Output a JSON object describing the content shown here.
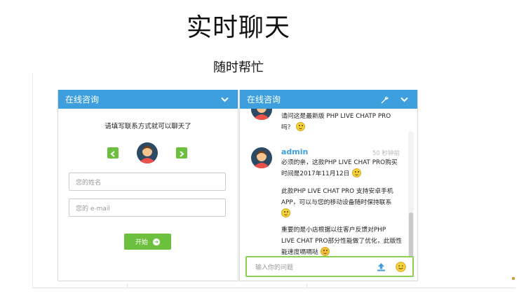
{
  "page": {
    "title": "实时聊天",
    "subtitle": "随时帮忙"
  },
  "left_panel": {
    "header": "在线咨询",
    "prompt": "请填写联系方式就可以聊天了",
    "name_placeholder": "您的姓名",
    "email_placeholder": "您的 e-mail",
    "start_label": "开始"
  },
  "right_panel": {
    "header": "在线咨询",
    "messages": [
      {
        "sender": "",
        "time": "",
        "lines": [
          "请问这是最新版 PHP LIVE CHATP PRO",
          "吗？"
        ]
      },
      {
        "sender": "admin",
        "time": "50 秒钟前",
        "paragraphs": [
          [
            "必须的亲，这款PHP LIVE CHAT PRO购买",
            "时间是2017年11月12日"
          ],
          [
            "此款PHP LIVE CHAT PRO 支持安卓手机",
            "APP，可以与您的移动设备随时保持联系"
          ],
          [
            "重要的是小店根据以往客户反馈对PHP",
            "LIVE CHAT PRO部分性能做了优化，此版性",
            "能速度嗝嗝哒"
          ]
        ]
      }
    ],
    "input_placeholder": "输入你的问题"
  },
  "icons": {
    "header_toggle": "chevron-down-icon",
    "settings": "wrench-icon",
    "prev": "chevron-left-icon",
    "next": "chevron-right-icon",
    "start": "arrow-right-circle-icon",
    "upload": "upload-icon",
    "emoji": "smiley-icon"
  },
  "colors": {
    "header_blue": "#3d9fdd",
    "accent_green": "#6dbf3e",
    "input_border": "#8cd04f",
    "emoji_yellow": "#f3d23c"
  }
}
